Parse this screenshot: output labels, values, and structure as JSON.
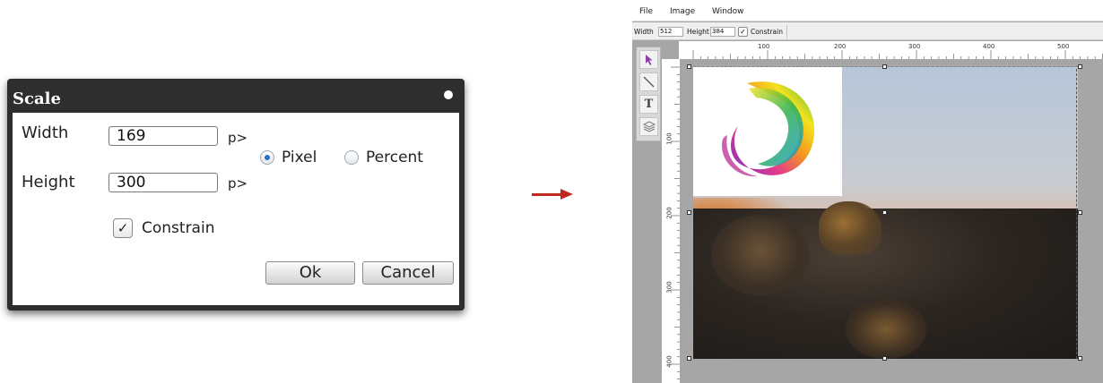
{
  "scale_dialog": {
    "title": "Scale",
    "width_label": "Width",
    "width_value": "169",
    "width_unit": "p>",
    "height_label": "Height",
    "height_value": "300",
    "height_unit": "p>",
    "pixel_option": "Pixel",
    "percent_option": "Percent",
    "selected_unit": "Pixel",
    "constrain_label": "Constrain",
    "constrain_checked": true,
    "ok_label": "Ok",
    "cancel_label": "Cancel"
  },
  "editor": {
    "menu": [
      "File",
      "Image",
      "Window"
    ],
    "width_label": "Width",
    "width_value": "512",
    "height_label": "Height",
    "height_value": "384",
    "constrain_label": "Constrain",
    "constrain_checked": true,
    "tools": [
      "pointer-icon",
      "line-icon",
      "text-icon",
      "layers-icon"
    ],
    "text_tool_glyph": "T",
    "ruler_top": [
      "100",
      "200",
      "300",
      "400",
      "500"
    ],
    "ruler_left": [
      "100",
      "200",
      "300",
      "400"
    ]
  },
  "colors": {
    "arrow": "#c0271e",
    "dialog_title_bar": "#2e2e2e",
    "radio_selected": "#2a6fc9"
  }
}
